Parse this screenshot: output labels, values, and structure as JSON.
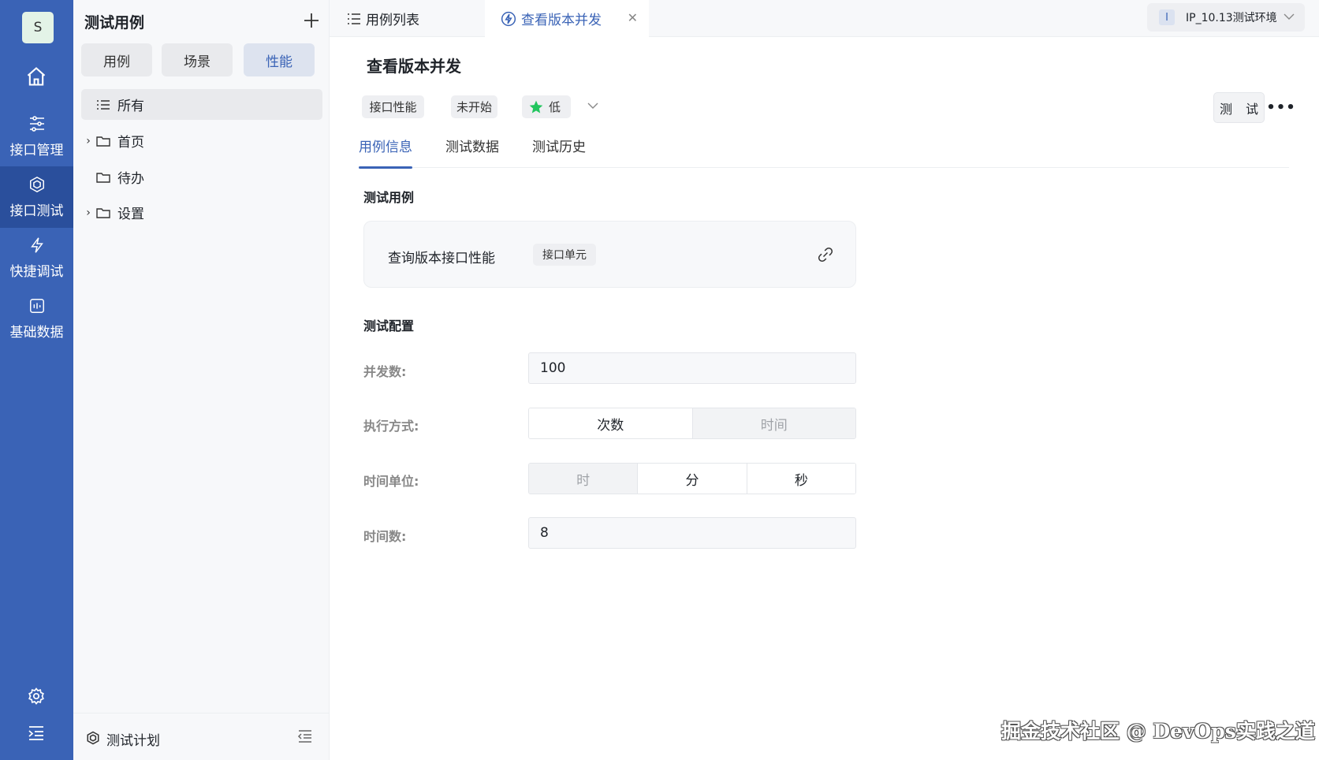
{
  "rail": {
    "avatar": "S",
    "items": [
      {
        "label": "接口管理",
        "icon": "sliders-icon"
      },
      {
        "label": "接口测试",
        "icon": "hexagon-cube-icon"
      },
      {
        "label": "快捷调试",
        "icon": "lightning-icon"
      },
      {
        "label": "基础数据",
        "icon": "chart-box-icon"
      }
    ],
    "active_index": 1
  },
  "panel": {
    "title": "测试用例",
    "segments": [
      "用例",
      "场景",
      "性能"
    ],
    "active_segment": 2,
    "tree": [
      {
        "label": "所有",
        "expandable": false,
        "icon": "list-icon"
      },
      {
        "label": "首页",
        "expandable": true,
        "icon": "folder-icon"
      },
      {
        "label": "待办",
        "expandable": false,
        "icon": "folder-icon"
      },
      {
        "label": "设置",
        "expandable": true,
        "icon": "folder-icon"
      }
    ],
    "footer": {
      "label": "测试计划"
    }
  },
  "tabs": [
    {
      "label": "用例列表",
      "icon": "list-icon"
    },
    {
      "label": "查看版本并发",
      "icon": "lightning-circle-icon",
      "active": true
    }
  ],
  "env": {
    "badge": "I",
    "label": "IP_10.13测试环境"
  },
  "main": {
    "title": "查看版本并发",
    "tags": [
      "接口性能",
      "未开始"
    ],
    "priority": "低",
    "test_button": "测 试",
    "subtabs": [
      "用例信息",
      "测试数据",
      "测试历史"
    ],
    "active_subtab": 0,
    "case_section": "测试用例",
    "case": {
      "name": "查询版本接口性能",
      "tag": "接口单元"
    },
    "config_section": "测试配置",
    "config": {
      "concurrency_label": "并发数:",
      "concurrency_value": "100",
      "mode_label": "执行方式:",
      "mode_options": [
        "次数",
        "时间"
      ],
      "mode_selected": "次数",
      "unit_label": "时间单位:",
      "unit_options": [
        "时",
        "分",
        "秒"
      ],
      "time_count_label": "时间数:",
      "time_count_value": "8"
    }
  },
  "watermark": "掘金技术社区 @ DevOps实践之道",
  "colors": {
    "primary": "#3a63b6",
    "rail": "#3a63b6",
    "rail_active": "#2a4f9c",
    "priority_star": "#22c55e"
  }
}
